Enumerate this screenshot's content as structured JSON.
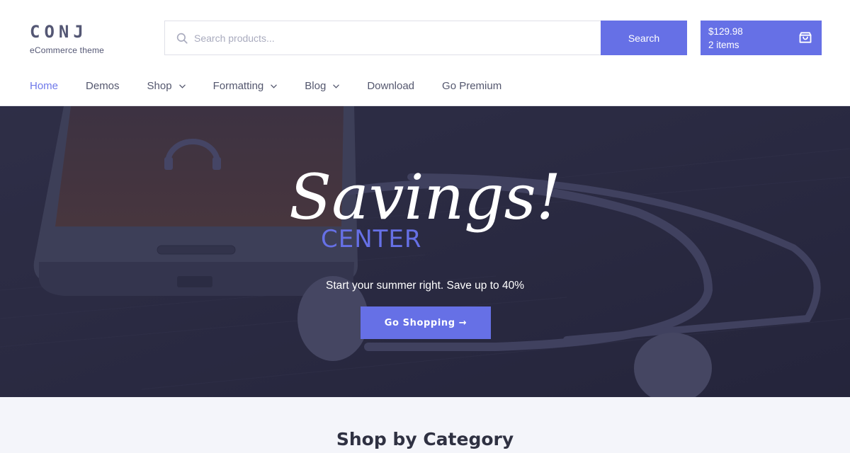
{
  "brand": {
    "title": "CONJ",
    "tagline": "eCommerce theme"
  },
  "search": {
    "placeholder": "Search products...",
    "value": "",
    "button_label": "Search",
    "icon": "search-icon"
  },
  "cart": {
    "total": "$129.98",
    "items": "2 items",
    "icon": "shopping-bag-icon"
  },
  "nav": {
    "items": [
      {
        "label": "Home",
        "active": true,
        "dropdown": false
      },
      {
        "label": "Demos",
        "active": false,
        "dropdown": false
      },
      {
        "label": "Shop",
        "active": false,
        "dropdown": true
      },
      {
        "label": "Formatting",
        "active": false,
        "dropdown": true
      },
      {
        "label": "Blog",
        "active": false,
        "dropdown": true
      },
      {
        "label": "Download",
        "active": false,
        "dropdown": false
      },
      {
        "label": "Go Premium",
        "active": false,
        "dropdown": false
      }
    ]
  },
  "hero": {
    "script_title": "Savings!",
    "subtitle_word": "CENTER",
    "tagline": "Start your summer right. Save up to 40%",
    "cta_label": "Go Shopping →",
    "background": "phone and earphones on dark wood table"
  },
  "category": {
    "title": "Shop by Category"
  },
  "colors": {
    "accent": "#6670e6",
    "nav_active": "#6f79ea",
    "text": "#54576e",
    "hero_overlay": "#2b2b43",
    "section_bg": "#f4f5fa"
  }
}
